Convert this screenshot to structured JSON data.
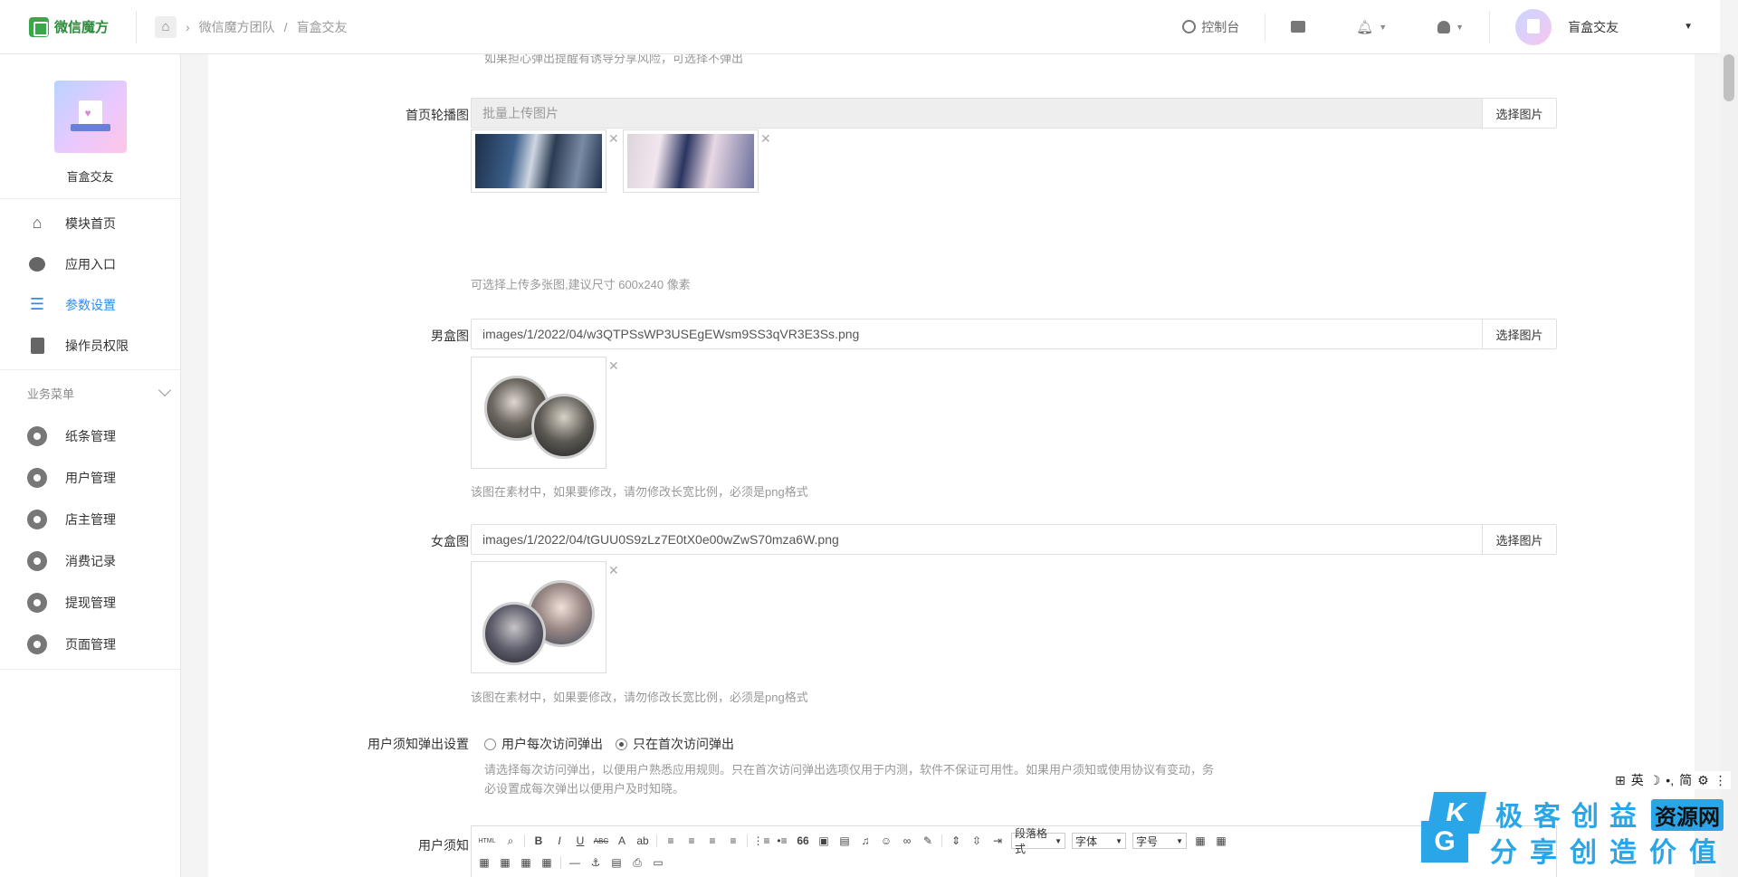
{
  "header": {
    "brand": "微信魔方",
    "breadcrumb": [
      "微信魔方团队",
      "/",
      "盲盒交友"
    ],
    "console": "控制台",
    "user_name": "盲盒交友"
  },
  "sidebar": {
    "app_name": "盲盒交友",
    "top_items": [
      {
        "label": "模块首页",
        "icon": "home-icon"
      },
      {
        "label": "应用入口",
        "icon": "chat-icon"
      },
      {
        "label": "参数设置",
        "icon": "list-icon",
        "active": true
      },
      {
        "label": "操作员权限",
        "icon": "edit-doc-icon"
      }
    ],
    "group_title": "业务菜单",
    "group_items": [
      {
        "label": "纸条管理"
      },
      {
        "label": "用户管理"
      },
      {
        "label": "店主管理"
      },
      {
        "label": "消费记录"
      },
      {
        "label": "提现管理"
      },
      {
        "label": "页面管理"
      }
    ]
  },
  "form": {
    "top_hint": "如果担心弹出提醒有诱导分享风险，可选择不弹出",
    "banner": {
      "label": "首页轮播图",
      "placeholder": "批量上传图片",
      "button": "选择图片",
      "help": "可选择上传多张图,建议尺寸 600x240 像素"
    },
    "male_box": {
      "label": "男盒图",
      "value": "images/1/2022/04/w3QTPSsWP3USEgEWsm9SS3qVR3E3Ss.png",
      "button": "选择图片",
      "help": "该图在素材中，如果要修改，请勿修改长宽比例，必须是png格式"
    },
    "female_box": {
      "label": "女盒图",
      "value": "images/1/2022/04/tGUU0S9zLz7E0tX0e00wZwS70mza6W.png",
      "button": "选择图片",
      "help": "该图在素材中，如果要修改，请勿修改长宽比例，必须是png格式"
    },
    "notice_popup": {
      "label": "用户须知弹出设置",
      "options": [
        "用户每次访问弹出",
        "只在首次访问弹出"
      ],
      "selected": 1,
      "help_line1": "请选择每次访问弹出，以便用户熟悉应用规则。只在首次访问弹出选项仅用于内测，软件不保证可用性。如果用户须知或使用协议有变动，务",
      "help_line2": "必设置成每次弹出以便用户及时知晓。"
    },
    "user_notice": {
      "label": "用户须知",
      "toolbar": {
        "html": "HTML",
        "bold": "B",
        "italic": "I",
        "underline": "U",
        "strike": "ABC",
        "font_color": "A",
        "quote": "66",
        "paragraph": "段落格式",
        "font": "字体",
        "size": "字号"
      }
    }
  },
  "ime": {
    "mode1": "英",
    "mode2": "简"
  },
  "watermark": {
    "k": "K",
    "g": "G",
    "line1": "极客创益",
    "badge": "资源网",
    "line2": "分享创造价值"
  }
}
